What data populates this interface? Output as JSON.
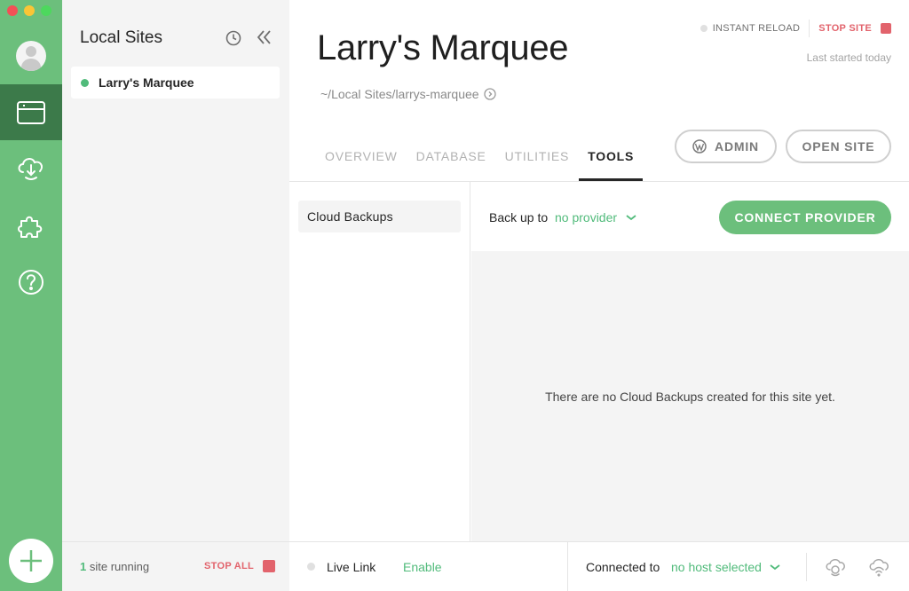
{
  "window": {
    "controls": [
      "close",
      "minimize",
      "maximize"
    ]
  },
  "rail": {
    "items": [
      {
        "name": "avatar",
        "icon": "user-avatar-icon"
      },
      {
        "name": "sites",
        "icon": "browser-window-icon",
        "active": true
      },
      {
        "name": "cloud",
        "icon": "cloud-download-icon"
      },
      {
        "name": "addons",
        "icon": "puzzle-piece-icon"
      },
      {
        "name": "help",
        "icon": "question-circle-icon"
      }
    ],
    "add_icon": "plus-icon"
  },
  "sites_panel": {
    "title": "Local Sites",
    "history_icon": "clock-icon",
    "collapse_icon": "double-chevron-left-icon",
    "sites": [
      {
        "name": "Larry's Marquee",
        "status": "running",
        "status_color": "#51bb7b"
      }
    ],
    "footer": {
      "running_count": "1",
      "running_text": " site running",
      "stop_all_label": "STOP ALL"
    }
  },
  "site": {
    "title": "Larry's Marquee",
    "path": "~/Local Sites/larrys-marquee",
    "instant_reload_label": "INSTANT RELOAD",
    "stop_site_label": "STOP SITE",
    "last_started": "Last started today",
    "tabs": [
      {
        "label": "OVERVIEW",
        "active": false
      },
      {
        "label": "DATABASE",
        "active": false
      },
      {
        "label": "UTILITIES",
        "active": false
      },
      {
        "label": "TOOLS",
        "active": true
      }
    ],
    "admin_label": "ADMIN",
    "open_site_label": "OPEN SITE"
  },
  "tools": {
    "nav": [
      {
        "label": "Cloud Backups",
        "active": true
      }
    ],
    "backup": {
      "label": "Back up to",
      "provider": "no provider",
      "connect_label": "CONNECT PROVIDER",
      "empty_message": "There are no Cloud Backups created for this site yet."
    }
  },
  "footer": {
    "live_link_label": "Live Link",
    "live_link_action": "Enable",
    "connected_label": "Connected to",
    "host": "no host selected",
    "icons": [
      "cloud-sync-icon",
      "wifi-cloud-icon"
    ]
  },
  "colors": {
    "accent": "#51bb7b",
    "rail": "#6cbf7c",
    "rail_active": "#3c7a4a",
    "danger": "#e2636c"
  }
}
